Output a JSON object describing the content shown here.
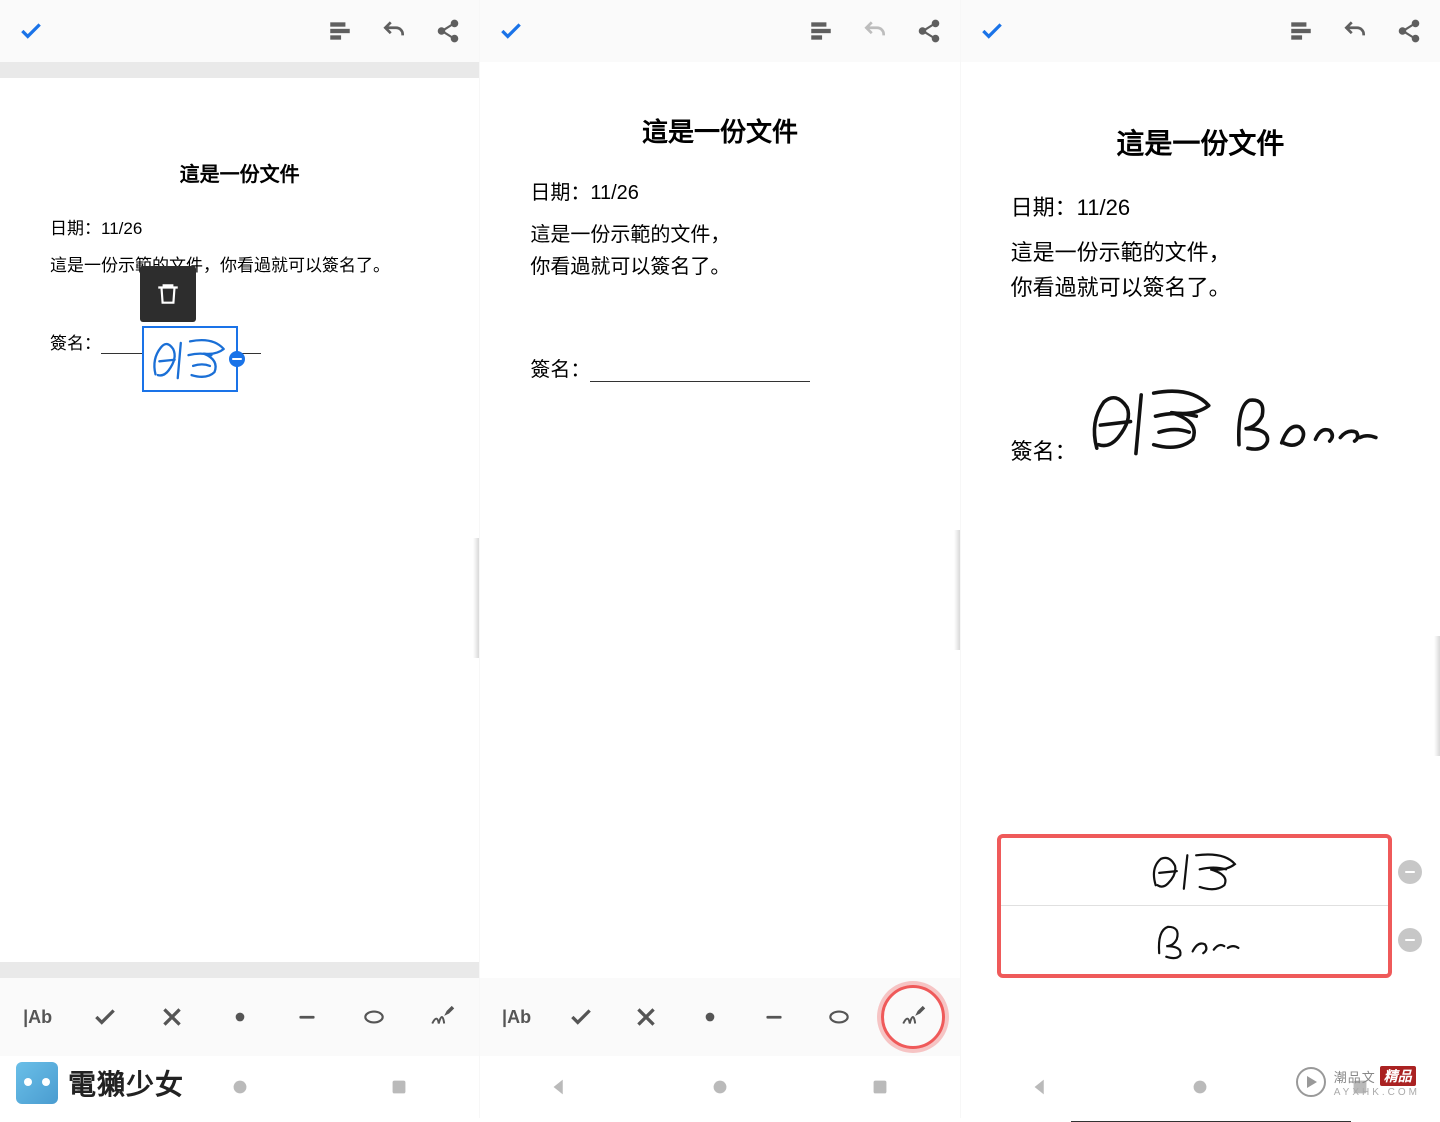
{
  "doc_title": "這是一份文件",
  "date_label": "日期：",
  "date_value": "11/26",
  "body_text": "這是一份示範的文件，你看過就可以簽名了。",
  "sign_label": "簽名：",
  "toolbar": {
    "text_tool": "|Ab"
  },
  "signature_options": {
    "option1": "貝爾",
    "option2": "Bear"
  },
  "brand_left": "電獺少女",
  "brand_right_main": "潮品文",
  "brand_right_tag": "精品",
  "brand_right_sub": "AYXHK.COM",
  "signature_preview": "貝爾"
}
